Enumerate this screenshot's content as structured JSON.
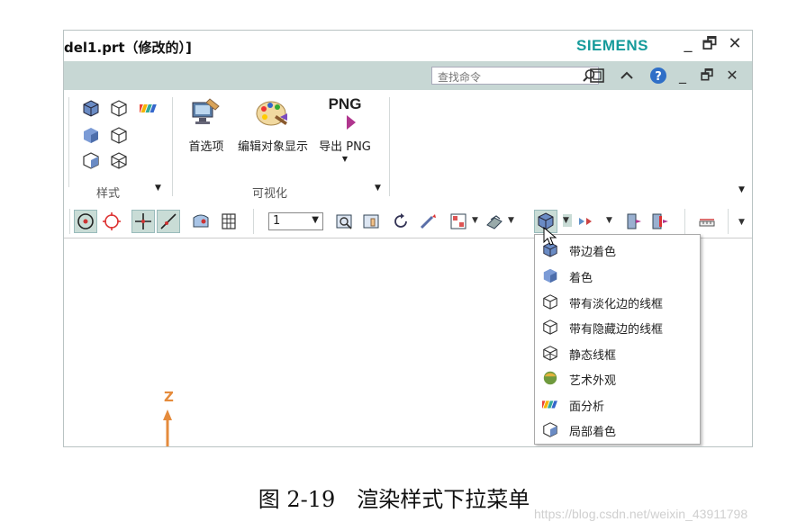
{
  "window": {
    "title": "del1.prt（修改的）]",
    "brand": "SIEMENS",
    "minimize": "_",
    "restore": "🗗",
    "close": "✕"
  },
  "command_bar": {
    "search_placeholder": "查找命令",
    "minimize": "_",
    "restore": "🗗",
    "close": "✕",
    "icons": [
      "search-icon",
      "fit-window-icon",
      "collapse-ribbon-icon",
      "help-icon"
    ]
  },
  "ribbon": {
    "style_group_label": "样式",
    "visualization_group_label": "可视化",
    "buttons": {
      "preferences": "首选项",
      "edit_object_display": "编辑对象显示",
      "export_png_icon_text": "PNG",
      "export_png": "导出 PNG"
    }
  },
  "toolbar": {
    "layer_value": "1"
  },
  "render_menu": {
    "items": [
      {
        "label": "带边着色",
        "icon": "shaded-with-edges-icon"
      },
      {
        "label": "着色",
        "icon": "shaded-icon"
      },
      {
        "label": "带有淡化边的线框",
        "icon": "wireframe-dim-edges-icon"
      },
      {
        "label": "带有隐藏边的线框",
        "icon": "wireframe-hidden-edges-icon"
      },
      {
        "label": "静态线框",
        "icon": "static-wireframe-icon"
      },
      {
        "label": "艺术外观",
        "icon": "artistic-appearance-icon"
      },
      {
        "label": "面分析",
        "icon": "face-analysis-icon"
      },
      {
        "label": "局部着色",
        "icon": "partial-shading-icon"
      }
    ]
  },
  "canvas": {
    "axis_label": "Z"
  },
  "caption": "图 2-19　渲染样式下拉菜单",
  "watermark": "https://blog.csdn.net/weixin_43911798",
  "colors": {
    "brand": "#169b9b",
    "command_bar": "#c7d7d4",
    "axis": "#e58b3c"
  }
}
